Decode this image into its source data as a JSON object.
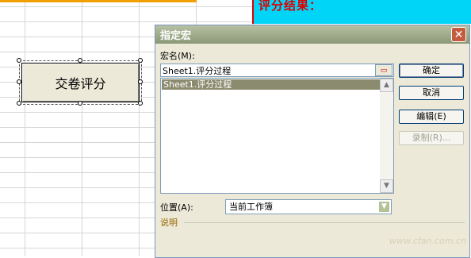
{
  "sheet": {
    "result_label": "评分结果：",
    "form_button_label": "交卷评分"
  },
  "dialog": {
    "title": "指定宏",
    "macro_name_label": "宏名(M):",
    "macro_name_value": "Sheet1.评分过程",
    "macros": [
      "Sheet1.评分过程"
    ],
    "buttons": {
      "ok": "确定",
      "cancel": "取消",
      "edit": "编辑(E)",
      "record": "录制(R)..."
    },
    "location_label": "位置(A):",
    "location_value": "当前工作簿",
    "description_label": "说明"
  },
  "watermark": "www.cfan.com.cn"
}
